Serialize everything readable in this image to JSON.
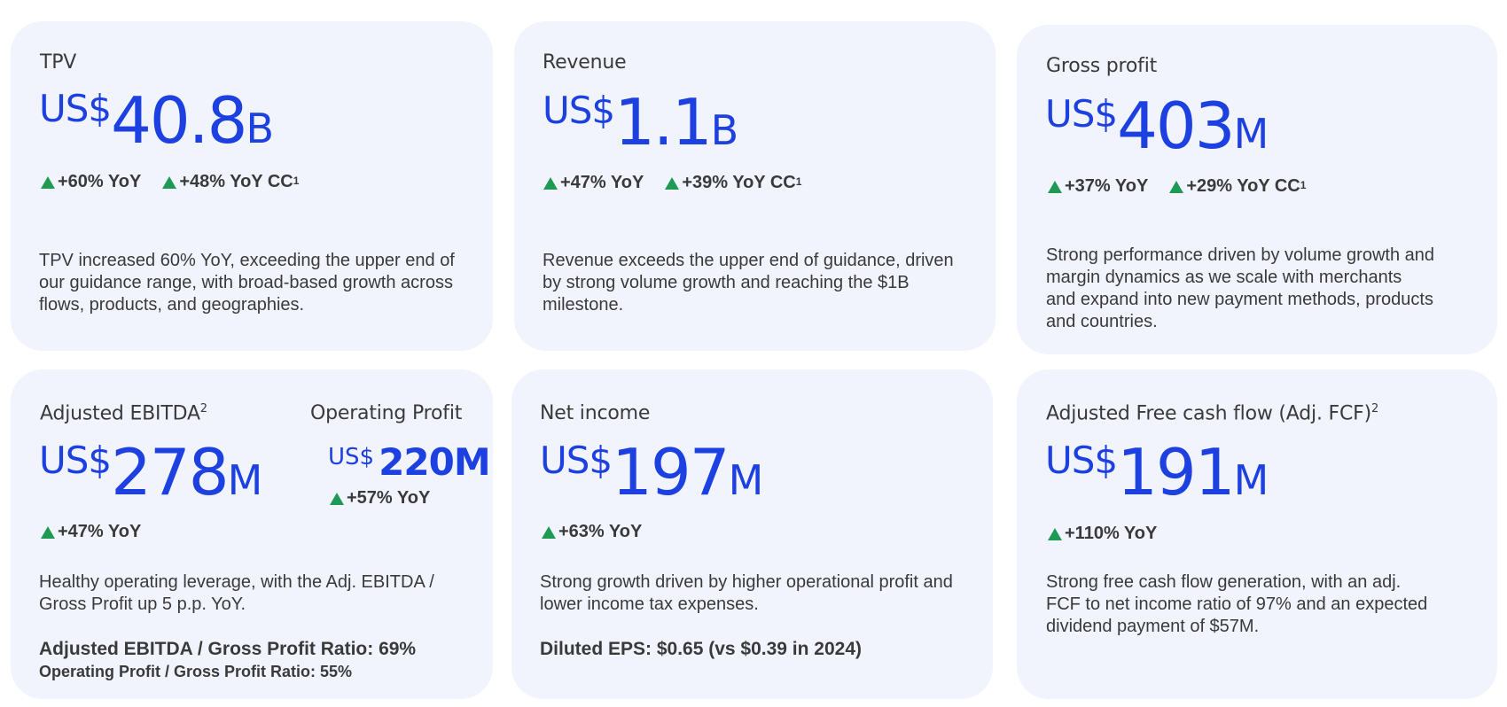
{
  "cards": [
    {
      "title": "TPV",
      "currency": "US$",
      "value": "40.8",
      "unit": "B",
      "growth": [
        "+60% YoY",
        "+48% YoY CC"
      ],
      "growth_sup": "1",
      "description": "TPV increased 60% YoY, exceeding the upper end of our guidance range, with broad-based growth across flows, products, and geographies."
    },
    {
      "title": "Revenue",
      "currency": "US$",
      "value": "1.1",
      "unit": "B",
      "growth": [
        "+47% YoY",
        "+39% YoY CC"
      ],
      "growth_sup": "1",
      "description": "Revenue exceeds the upper end of guidance, driven by strong volume growth and reaching the $1B milestone."
    },
    {
      "title": "Gross profit",
      "currency": "US$",
      "value": "403",
      "unit": "M",
      "growth": [
        "+37% YoY",
        "+29% YoY CC"
      ],
      "growth_sup": "1",
      "description": "Strong performance driven by volume growth and margin dynamics as we scale with merchants and expand into new payment methods, products and countries."
    },
    {
      "title": "Adjusted EBITDA",
      "title_sup": "2",
      "currency": "US$",
      "value": "278",
      "unit": "M",
      "growth": [
        "+47% YoY"
      ],
      "secondary": {
        "title": "Operating Profit",
        "currency": "US$",
        "value": "220M",
        "growth": "+57% YoY"
      },
      "description": "Healthy operating leverage, with the Adj. EBITDA / Gross Profit up 5 p.p. YoY.",
      "footnote_1": "Adjusted EBITDA / Gross Profit Ratio: 69%",
      "footnote_2": "Operating Profit / Gross Profit Ratio: 55%"
    },
    {
      "title": "Net income",
      "currency": "US$",
      "value": "197",
      "unit": "M",
      "growth": [
        "+63% YoY"
      ],
      "description": "Strong growth driven by higher operational profit and lower income tax expenses.",
      "footnote_1": "Diluted EPS: $0.65 (vs $0.39 in 2024)"
    },
    {
      "title": "Adjusted Free cash flow (Adj. FCF)",
      "title_sup": "2",
      "currency": "US$",
      "value": "191",
      "unit": "M",
      "growth": [
        "+110% YoY"
      ],
      "description": "Strong free cash flow generation, with an adj. FCF to net income ratio of 97% and an expected dividend payment of $57M."
    }
  ],
  "colors": {
    "card_background": "#f1f4fd",
    "metric_blue": "#1d40e0",
    "growth_arrow_green": "#1f9a55",
    "text": "#3a3a3a"
  },
  "icons": {
    "growth_indicator": "up-triangle-icon"
  }
}
